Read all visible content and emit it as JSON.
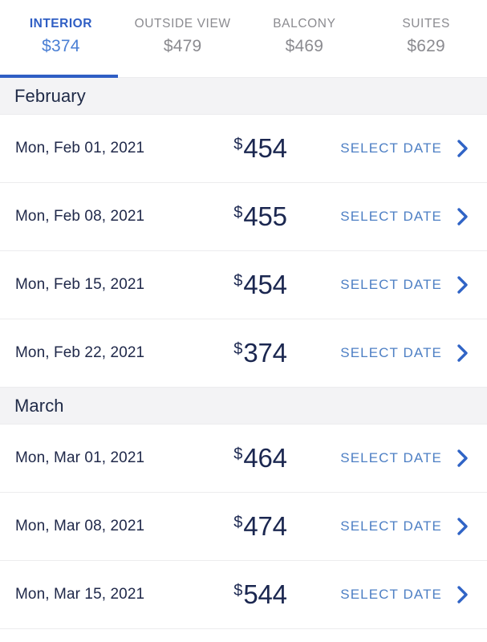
{
  "theme": {
    "accent_blue": "#2f5ec4",
    "link_blue": "#4d7fc4",
    "dark_navy": "#1b2750",
    "muted_gray": "#8b8b90",
    "band_gray": "#f3f3f5",
    "divider": "#ececee"
  },
  "tabs": [
    {
      "label": "INTERIOR",
      "price": "$374",
      "active": true
    },
    {
      "label": "OUTSIDE VIEW",
      "price": "$479",
      "active": false
    },
    {
      "label": "BALCONY",
      "price": "$469",
      "active": false
    },
    {
      "label": "SUITES",
      "price": "$629",
      "active": false
    }
  ],
  "sections": [
    {
      "month": "February",
      "rows": [
        {
          "date": "Mon, Feb 01, 2021",
          "currency": "$",
          "amount": "454",
          "action": "SELECT DATE",
          "chevron_icon": "chevron-right-icon"
        },
        {
          "date": "Mon, Feb 08, 2021",
          "currency": "$",
          "amount": "455",
          "action": "SELECT DATE",
          "chevron_icon": "chevron-right-icon"
        },
        {
          "date": "Mon, Feb 15, 2021",
          "currency": "$",
          "amount": "454",
          "action": "SELECT DATE",
          "chevron_icon": "chevron-right-icon"
        },
        {
          "date": "Mon, Feb 22, 2021",
          "currency": "$",
          "amount": "374",
          "action": "SELECT DATE",
          "chevron_icon": "chevron-right-icon"
        }
      ]
    },
    {
      "month": "March",
      "rows": [
        {
          "date": "Mon, Mar 01, 2021",
          "currency": "$",
          "amount": "464",
          "action": "SELECT DATE",
          "chevron_icon": "chevron-right-icon"
        },
        {
          "date": "Mon, Mar 08, 2021",
          "currency": "$",
          "amount": "474",
          "action": "SELECT DATE",
          "chevron_icon": "chevron-right-icon"
        },
        {
          "date": "Mon, Mar 15, 2021",
          "currency": "$",
          "amount": "544",
          "action": "SELECT DATE",
          "chevron_icon": "chevron-right-icon"
        }
      ]
    }
  ]
}
